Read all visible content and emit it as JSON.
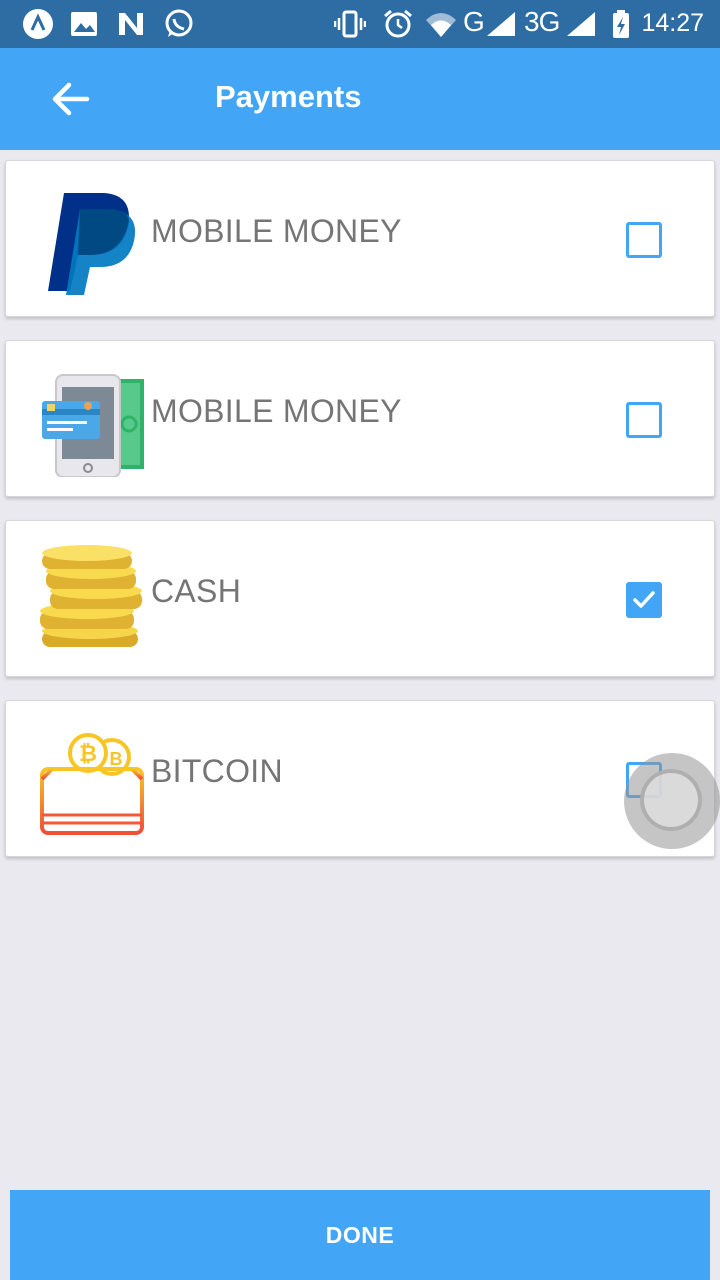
{
  "status_bar": {
    "time": "14:27",
    "network_1": "G",
    "network_2": "3G",
    "icons": [
      "app-a-icon",
      "image-icon",
      "n-app-icon",
      "whatsapp-icon",
      "vibrate-icon",
      "alarm-icon",
      "wifi-icon",
      "signal-icon",
      "battery-charging-icon"
    ]
  },
  "app_bar": {
    "title": "Payments",
    "back_icon": "arrow-back-icon"
  },
  "payment_options": [
    {
      "label": "MOBILE MONEY",
      "icon": "paypal-logo-icon",
      "checked": false
    },
    {
      "label": "MOBILE MONEY",
      "icon": "mobile-payment-icon",
      "checked": false
    },
    {
      "label": "CASH",
      "icon": "coins-icon",
      "checked": true
    },
    {
      "label": "BITCOIN",
      "icon": "bitcoin-wallet-icon",
      "checked": false
    }
  ],
  "done_button": {
    "label": "DONE"
  },
  "colors": {
    "primary": "#42a5f5",
    "status_bar": "#2d6da3",
    "background": "#e9e9ef",
    "label_text": "#757575"
  }
}
